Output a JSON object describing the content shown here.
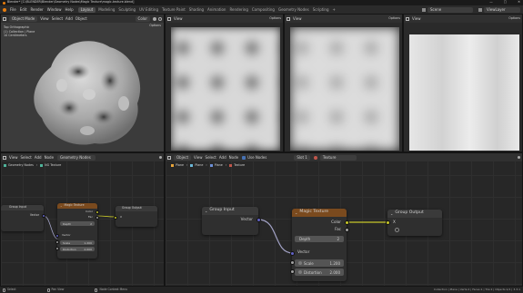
{
  "window": {
    "title": "Blender* [C:\\BLENDER\\Blender\\Geometry Nodes\\Magic Texture\\magic-texture.blend]",
    "controls": [
      "—",
      "▢",
      "✕"
    ]
  },
  "menu": [
    "File",
    "Edit",
    "Render",
    "Window",
    "Help"
  ],
  "workspaces": [
    "Layout",
    "Modeling",
    "Sculpting",
    "UV Editing",
    "Texture Paint",
    "Shading",
    "Animation",
    "Rendering",
    "Compositing",
    "Geometry Nodes",
    "Scripting",
    "+"
  ],
  "active_workspace": "Layout",
  "scene": {
    "label": "Scene",
    "view_layer": "ViewLayer"
  },
  "viewport": {
    "mode": "Object Mode",
    "menus": [
      "View",
      "Select",
      "Add",
      "Object"
    ],
    "shading": "Color",
    "options": "Options",
    "overlay_lines": [
      "Top Orthographic",
      "(1) Collection | Plane",
      "10 Centimeters"
    ]
  },
  "image_editors": [
    {
      "view": "View",
      "options": "Options"
    },
    {
      "view": "View",
      "options": "Options"
    },
    {
      "view": "View",
      "options": "Options"
    }
  ],
  "left_node_editor": {
    "editor": "Geometry Node Editor",
    "menus": [
      "View",
      "Select",
      "Add",
      "Node"
    ],
    "tree": "Geometry Nodes",
    "breadcrumb": [
      "Geometry Nodes",
      "NG Texture"
    ],
    "nodes": {
      "group_input": {
        "title": "Group Input",
        "outputs": [
          "Vector"
        ]
      },
      "magic": {
        "title": "Magic Texture",
        "outputs": [
          "Color",
          "Fac"
        ],
        "depth_label": "Depth",
        "depth_value": "2",
        "vector_label": "Vector",
        "scale_label": "Scale",
        "scale_value": "1.200",
        "distortion_label": "Distortion",
        "distortion_value": "2.000"
      },
      "group_output": {
        "title": "Group Output",
        "inputs": [
          "X"
        ]
      }
    }
  },
  "right_node_editor": {
    "editor": "Object",
    "menus": [
      "View",
      "Select",
      "Add",
      "Node"
    ],
    "use_nodes_label": "Use Nodes",
    "slot": "Slot 1",
    "breadcrumb": [
      "Plane",
      "Plane",
      "Plane",
      "Texture"
    ],
    "nodes": {
      "group_input": {
        "title": "Group Input",
        "outputs": [
          "Vector"
        ]
      },
      "magic": {
        "title": "Magic Texture",
        "outputs": [
          "Color",
          "Fac"
        ],
        "depth_label": "Depth",
        "depth_value": "2",
        "vector_label": "Vector",
        "scale_label": "Scale",
        "scale_value": "1.200",
        "distortion_label": "Distortion",
        "distortion_value": "2.000"
      },
      "group_output": {
        "title": "Group Output",
        "inputs": [
          "X"
        ]
      }
    }
  },
  "statusbar": {
    "hints": [
      "Select",
      "Pan View",
      "Node Context Menu"
    ],
    "version": "Collection | Plane | Verts:4 | Faces:1 | Tris:2 | Objects:1/1 | 3.3.1"
  },
  "colors": {
    "magic_header": "#7a4a1e",
    "node_header": "#3a3a3a",
    "socket_vector": "#6363c7",
    "socket_color": "#c7c729",
    "socket_float": "#a1a1a1",
    "link": "#a3a3c7",
    "link_color": "#c7c729",
    "accent_tab": "#4c4c4c"
  }
}
